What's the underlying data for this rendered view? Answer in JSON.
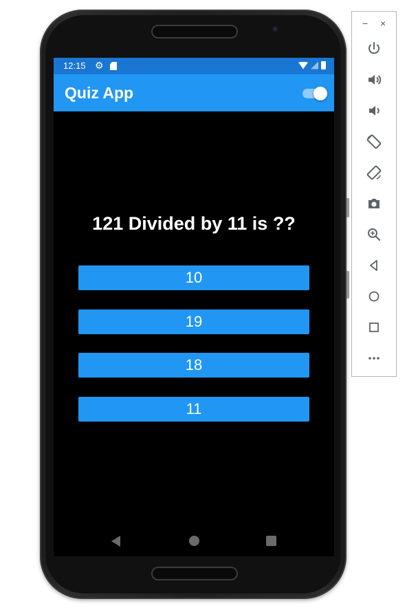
{
  "status_bar": {
    "time": "12:15",
    "color": "#1976d2"
  },
  "app_bar": {
    "title": "Quiz App",
    "color": "#2196f3",
    "toggle_on": true
  },
  "quiz": {
    "question": "121 Divided by 11 is ??",
    "answers": [
      "10",
      "19",
      "18",
      "11"
    ],
    "button_color": "#2196f3"
  },
  "emulator_toolbar": {
    "minimize": "−",
    "close": "×",
    "tools": [
      "power-icon",
      "volume-up-icon",
      "volume-down-icon",
      "rotate-left-icon",
      "rotate-right-icon",
      "camera-icon",
      "zoom-icon",
      "back-icon",
      "home-icon",
      "overview-icon",
      "more-icon"
    ]
  }
}
